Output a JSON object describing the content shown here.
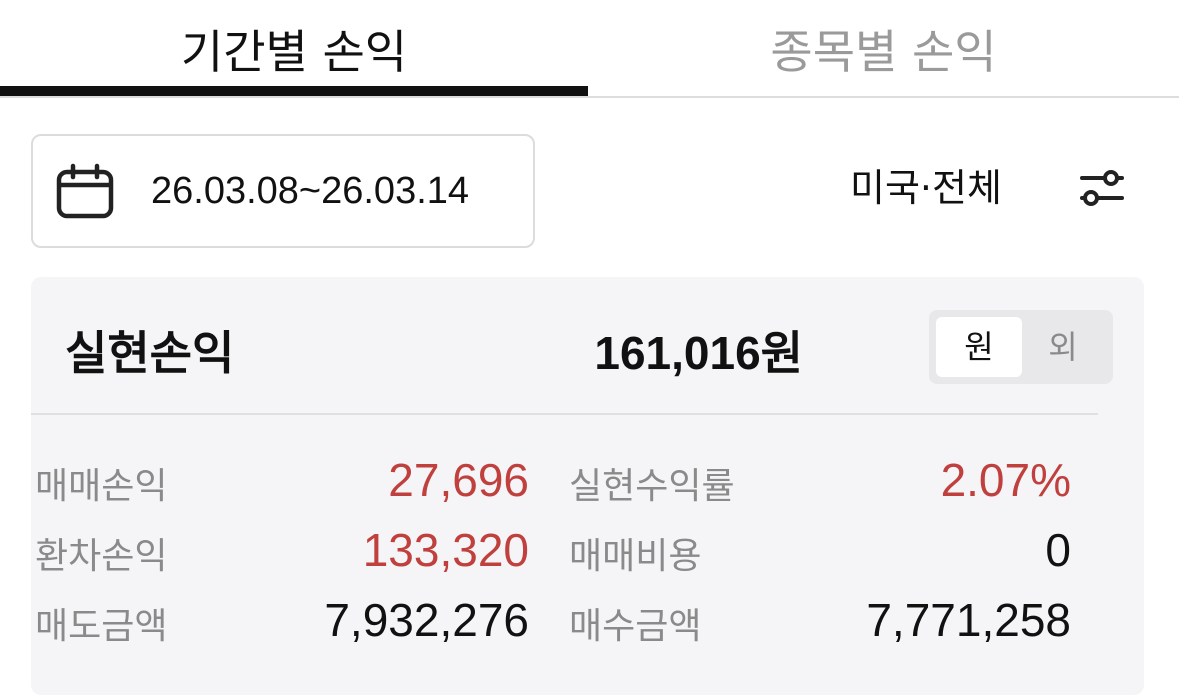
{
  "tabs": {
    "period": "기간별 손익",
    "stock": "종목별 손익"
  },
  "filter": {
    "date_range": "26.03.08~26.03.14",
    "region": "미국·전체"
  },
  "summary": {
    "title": "실현손익",
    "total_value": "161,016",
    "total_unit": "원",
    "currency_toggle": {
      "won": "원",
      "foreign": "외"
    }
  },
  "details": {
    "trade_pl_label": "매매손익",
    "trade_pl_value": "27,696",
    "fx_pl_label": "환차손익",
    "fx_pl_value": "133,320",
    "sell_amount_label": "매도금액",
    "sell_amount_value": "7,932,276",
    "return_rate_label": "실현수익률",
    "return_rate_value": "2.07%",
    "trade_cost_label": "매매비용",
    "trade_cost_value": "0",
    "buy_amount_label": "매수금액",
    "buy_amount_value": "7,771,258"
  },
  "colors": {
    "positive": "#c0403e",
    "text": "#111111",
    "muted": "#8a8a8a",
    "card_bg": "#f5f5f7"
  }
}
